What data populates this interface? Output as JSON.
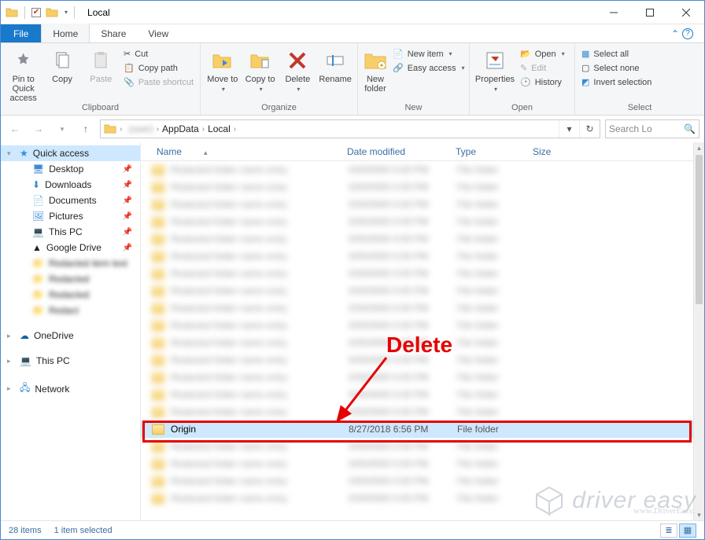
{
  "window": {
    "title": "Local"
  },
  "menu": {
    "file": "File",
    "home": "Home",
    "share": "Share",
    "view": "View"
  },
  "ribbon": {
    "clipboard": {
      "label": "Clipboard",
      "pin": "Pin to Quick access",
      "copy": "Copy",
      "paste": "Paste",
      "cut": "Cut",
      "copypath": "Copy path",
      "pasteshortcut": "Paste shortcut"
    },
    "organize": {
      "label": "Organize",
      "moveto": "Move to",
      "copyto": "Copy to",
      "delete": "Delete",
      "rename": "Rename"
    },
    "new": {
      "label": "New",
      "newfolder": "New folder",
      "newitem": "New item",
      "easyaccess": "Easy access"
    },
    "open": {
      "label": "Open",
      "properties": "Properties",
      "open": "Open",
      "edit": "Edit",
      "history": "History"
    },
    "select": {
      "label": "Select",
      "selectall": "Select all",
      "selectnone": "Select none",
      "invert": "Invert selection"
    }
  },
  "address": {
    "crumbs": [
      "(user)",
      "AppData",
      "Local"
    ],
    "searchPlaceholder": "Search Lo"
  },
  "nav": {
    "quick": "Quick access",
    "items": [
      "Desktop",
      "Downloads",
      "Documents",
      "Pictures",
      "This PC",
      "Google Drive"
    ],
    "onedrive": "OneDrive",
    "thispc": "This PC",
    "network": "Network"
  },
  "columns": {
    "name": "Name",
    "date": "Date modified",
    "type": "Type",
    "size": "Size"
  },
  "selectedRow": {
    "name": "Origin",
    "date": "8/27/2018 6:56 PM",
    "type": "File folder"
  },
  "status": {
    "count": "28 items",
    "sel": "1 item selected"
  },
  "annotation": {
    "delete": "Delete"
  },
  "watermark": {
    "brand": "driver easy",
    "url": "www.DriverEasy."
  }
}
